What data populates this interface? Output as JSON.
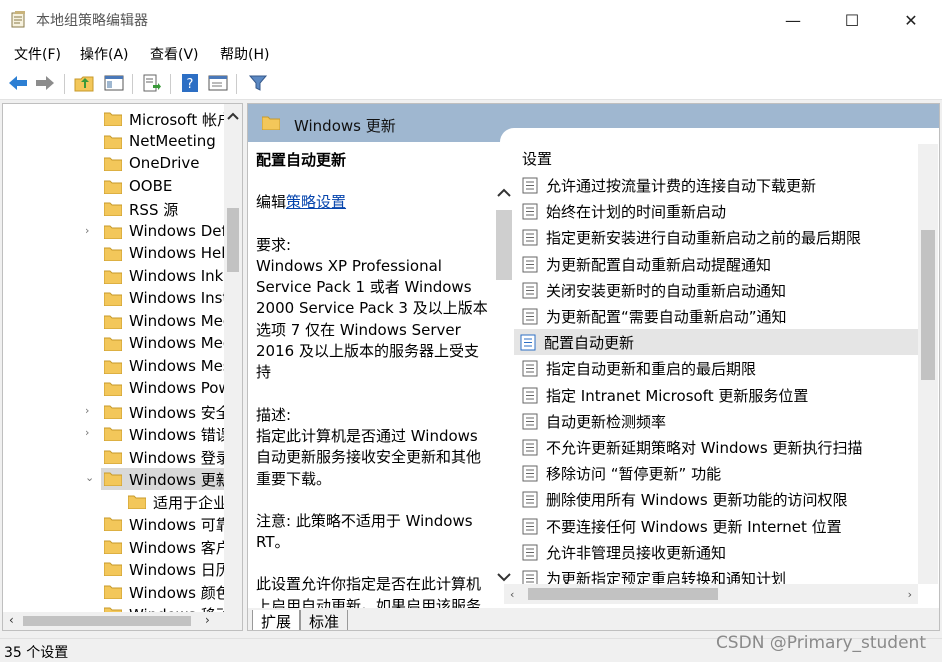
{
  "window": {
    "title": "本地组策略编辑器",
    "minimize": "—",
    "maximize": "☐",
    "close": "✕"
  },
  "menu": [
    "文件(F)",
    "操作(A)",
    "查看(V)",
    "帮助(H)"
  ],
  "toolbar": [
    "back-icon",
    "forward-icon",
    "up-folder-icon",
    "show-hide-tree-icon",
    "export-list-icon",
    "help-icon",
    "properties-icon",
    "filter-icon"
  ],
  "tree": {
    "items": [
      {
        "label": "Microsoft 帐户",
        "expandable": false
      },
      {
        "label": "NetMeeting",
        "expandable": false
      },
      {
        "label": "OneDrive",
        "expandable": false
      },
      {
        "label": "OOBE",
        "expandable": false
      },
      {
        "label": "RSS 源",
        "expandable": false
      },
      {
        "label": "Windows Defender",
        "expandable": true
      },
      {
        "label": "Windows Hello",
        "expandable": false
      },
      {
        "label": "Windows Ink",
        "expandable": false
      },
      {
        "label": "Windows Installer",
        "expandable": false
      },
      {
        "label": "Windows Media",
        "expandable": false
      },
      {
        "label": "Windows Media",
        "expandable": false
      },
      {
        "label": "Windows Messenger",
        "expandable": false
      },
      {
        "label": "Windows PowerShell",
        "expandable": false
      },
      {
        "label": "Windows 安全",
        "expandable": true
      },
      {
        "label": "Windows 错误报告",
        "expandable": true
      },
      {
        "label": "Windows 登录",
        "expandable": false
      },
      {
        "label": "Windows 更新",
        "expandable": true,
        "expanded": true,
        "selected": true
      },
      {
        "label": "适用于企业",
        "expandable": false,
        "child": true
      },
      {
        "label": "Windows 可靠",
        "expandable": false
      },
      {
        "label": "Windows 客户",
        "expandable": false
      },
      {
        "label": "Windows 日历",
        "expandable": false
      },
      {
        "label": "Windows 颜色",
        "expandable": false
      },
      {
        "label": "Windows 移动",
        "expandable": false
      }
    ]
  },
  "header": {
    "title": "Windows 更新"
  },
  "description": {
    "title": "配置自动更新",
    "edit_prefix": "编辑",
    "edit_link": "策略设置",
    "requirements_label": "要求:",
    "requirements": "Windows XP Professional Service Pack 1 或者 Windows 2000 Service Pack 3 及以上版本 选项 7 仅在 Windows Server 2016 及以上版本的服务器上受支持",
    "description_label": "描述:",
    "description": "指定此计算机是否通过 Windows 自动更新服务接收安全更新和其他重要下载。",
    "note": "注意: 此策略不适用于 Windows RT。",
    "more": "此设置允许你指定是否在此计算机上启用自动更新。如果启用该服务"
  },
  "settings": {
    "header": "设置",
    "items": [
      "允许通过按流量计费的连接自动下载更新",
      "始终在计划的时间重新启动",
      "指定更新安装进行自动重新启动之前的最后期限",
      "为更新配置自动重新启动提醒通知",
      "关闭安装更新时的自动重新启动通知",
      "为更新配置“需要自动重新启动”通知",
      "配置自动更新",
      "指定自动更新和重启的最后期限",
      "指定 Intranet Microsoft 更新服务位置",
      "自动更新检测频率",
      "不允许更新延期策略对 Windows 更新执行扫描",
      "移除访问 “暂停更新” 功能",
      "删除使用所有 Windows 更新功能的访问权限",
      "不要连接任何 Windows 更新 Internet 位置",
      "允许非管理员接收更新通知",
      "为更新指定预定重启转换和通知计划"
    ],
    "selected_index": 6
  },
  "tabs": [
    "扩展",
    "标准"
  ],
  "status": {
    "text": "35 个设置"
  },
  "watermark": "CSDN @Primary_student",
  "colors": {
    "header_band": "#9fb7d0",
    "folder": "#f3c75a",
    "link": "#0645ad",
    "selected": "#e5e5e5"
  }
}
